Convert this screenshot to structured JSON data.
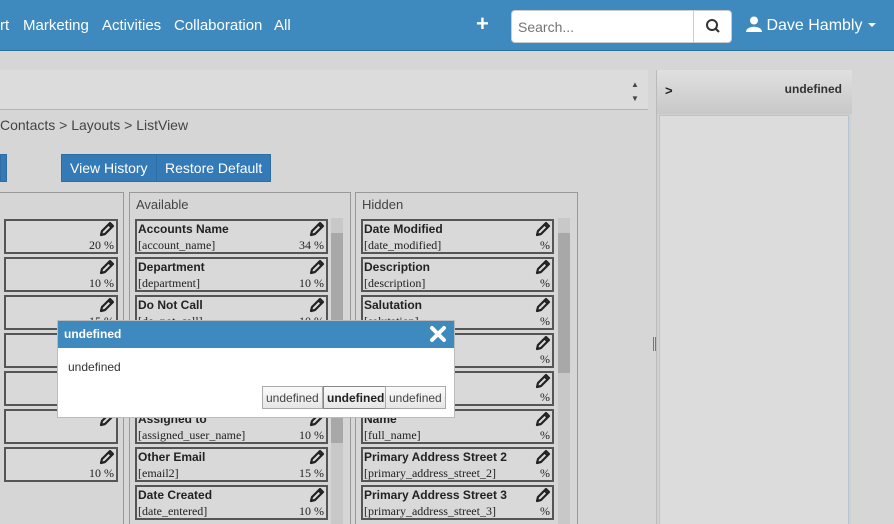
{
  "nav": {
    "items": [
      "rt",
      "Marketing",
      "Activities",
      "Collaboration",
      "All"
    ],
    "search_placeholder": "Search...",
    "user_name": "Dave Hambly"
  },
  "breadcrumb": "Contacts > Layouts > ListView",
  "buttons": {
    "view_history": "View History",
    "restore_default": "Restore Default"
  },
  "left_panel": {
    "rows": [
      {
        "pct": "20 %"
      },
      {
        "pct": "10 %"
      },
      {
        "pct": "15 %"
      },
      {
        "pct": ""
      },
      {
        "pct": ""
      },
      {
        "pct": ""
      },
      {
        "pct": "10 %"
      }
    ]
  },
  "available": {
    "title": "Available",
    "fields": [
      {
        "name": "Accounts Name",
        "key": "[account_name]",
        "pct": "34 %"
      },
      {
        "name": "Department",
        "key": "[department]",
        "pct": "10 %"
      },
      {
        "name": "Do Not Call",
        "key": "[do_not_call]",
        "pct": "10 %"
      },
      {
        "name": "",
        "key": "",
        "pct": ""
      },
      {
        "name": "",
        "key": "",
        "pct": ""
      },
      {
        "name": "Assigned to",
        "key": "[assigned_user_name]",
        "pct": "10 %"
      },
      {
        "name": "Other Email",
        "key": "[email2]",
        "pct": "15 %"
      },
      {
        "name": "Date Created",
        "key": "[date_entered]",
        "pct": "10 %"
      }
    ]
  },
  "hidden": {
    "title": "Hidden",
    "fields": [
      {
        "name": "Date Modified",
        "key": "[date_modified]",
        "pct": "%"
      },
      {
        "name": "Description",
        "key": "[description]",
        "pct": "%"
      },
      {
        "name": "Salutation",
        "key": "[salutation]",
        "pct": "%"
      },
      {
        "name": "",
        "key": "",
        "pct": "%"
      },
      {
        "name": "",
        "key": "",
        "pct": "%"
      },
      {
        "name": "Name",
        "key": "[full_name]",
        "pct": "%"
      },
      {
        "name": "Primary Address Street 2",
        "key": "[primary_address_street_2]",
        "pct": "%"
      },
      {
        "name": "Primary Address Street 3",
        "key": "[primary_address_street_3]",
        "pct": "%"
      }
    ]
  },
  "side_panel": {
    "toggle": ">",
    "title": "undefined"
  },
  "dialog": {
    "title": "undefined",
    "body": "undefined",
    "buttons": [
      "undefined",
      "undefined",
      "undefined"
    ]
  }
}
